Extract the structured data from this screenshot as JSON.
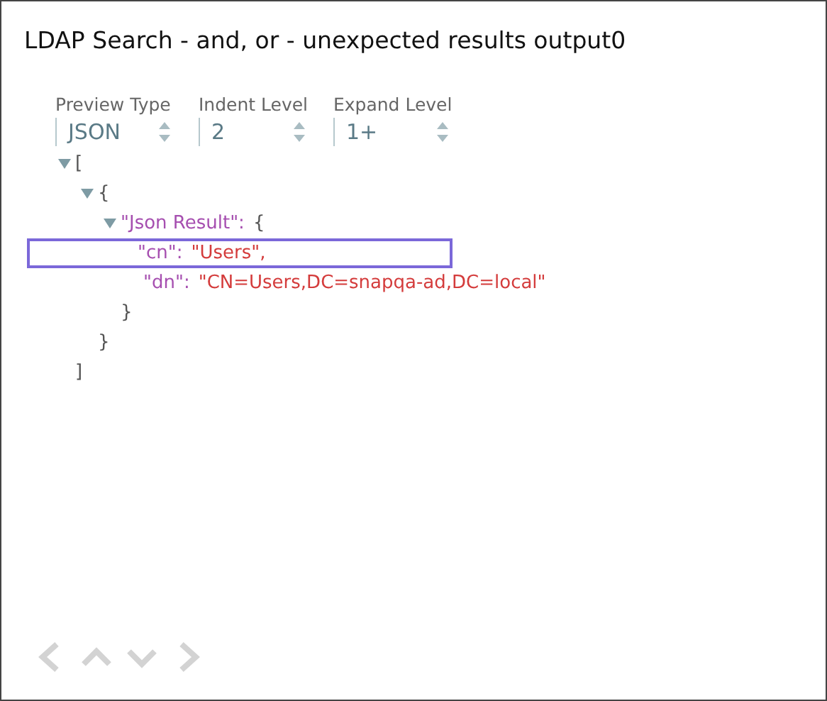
{
  "window": {
    "title": "LDAP Search - and, or - unexpected results output0"
  },
  "controls": [
    {
      "label": "Preview Type",
      "value": "JSON"
    },
    {
      "label": "Indent Level",
      "value": "2"
    },
    {
      "label": "Expand Level",
      "value": "1+"
    }
  ],
  "tree": {
    "open": "[",
    "close": "]",
    "expanded": true,
    "children": [
      {
        "open": "{",
        "close": "}",
        "expanded": true,
        "children": [
          {
            "key": "\"Json Result\":",
            "open": "{",
            "close": "}",
            "expanded": true,
            "children": [
              {
                "key": "\"cn\":",
                "value": "\"Users\",",
                "selected": true
              },
              {
                "key": "\"dn\":",
                "value": "\"CN=Users,DC=snapqa-ad,DC=local\"",
                "selected": false
              }
            ]
          }
        ]
      }
    ]
  }
}
